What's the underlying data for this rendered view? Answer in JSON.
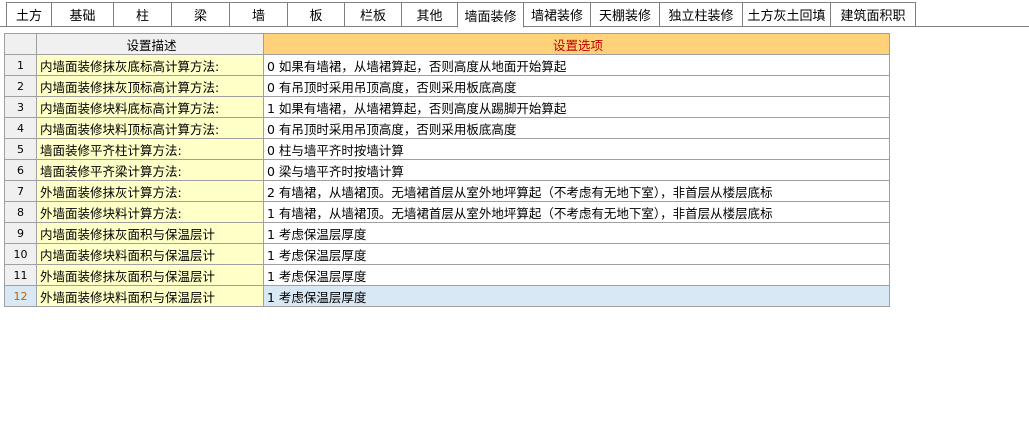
{
  "tabs": [
    {
      "label": "土方"
    },
    {
      "label": "基础"
    },
    {
      "label": "柱"
    },
    {
      "label": "梁"
    },
    {
      "label": "墙"
    },
    {
      "label": "板"
    },
    {
      "label": "栏板"
    },
    {
      "label": "其他"
    },
    {
      "label": "墙面装修"
    },
    {
      "label": "墙裙装修"
    },
    {
      "label": "天棚装修"
    },
    {
      "label": "独立柱装修"
    },
    {
      "label": "土方灰土回填"
    },
    {
      "label": "建筑面积职"
    }
  ],
  "active_tab": "墙面装修",
  "grid": {
    "header_desc": "设置描述",
    "header_option": "设置选项",
    "rows": [
      {
        "num": "1",
        "desc": "内墙面装修抹灰底标高计算方法:",
        "option": "0 如果有墙裙，从墙裙算起，否则高度从地面开始算起"
      },
      {
        "num": "2",
        "desc": "内墙面装修抹灰顶标高计算方法:",
        "option": "0 有吊顶时采用吊顶高度，否则采用板底高度"
      },
      {
        "num": "3",
        "desc": "内墙面装修块料底标高计算方法:",
        "option": "1 如果有墙裙，从墙裙算起，否则高度从踢脚开始算起"
      },
      {
        "num": "4",
        "desc": "内墙面装修块料顶标高计算方法:",
        "option": "0 有吊顶时采用吊顶高度，否则采用板底高度"
      },
      {
        "num": "5",
        "desc": "墙面装修平齐柱计算方法:",
        "option": "0 柱与墙平齐时按墙计算"
      },
      {
        "num": "6",
        "desc": "墙面装修平齐梁计算方法:",
        "option": "0 梁与墙平齐时按墙计算"
      },
      {
        "num": "7",
        "desc": "外墙面装修抹灰计算方法:",
        "option": "2 有墙裙，从墙裙顶。无墙裙首层从室外地坪算起（不考虑有无地下室），非首层从楼层底标"
      },
      {
        "num": "8",
        "desc": "外墙面装修块料计算方法:",
        "option": "1 有墙裙，从墙裙顶。无墙裙首层从室外地坪算起（不考虑有无地下室），非首层从楼层底标"
      },
      {
        "num": "9",
        "desc": "内墙面装修抹灰面积与保温层计",
        "option": "1 考虑保温层厚度"
      },
      {
        "num": "10",
        "desc": "内墙面装修块料面积与保温层计",
        "option": "1 考虑保温层厚度"
      },
      {
        "num": "11",
        "desc": "外墙面装修抹灰面积与保温层计",
        "option": "1 考虑保温层厚度"
      },
      {
        "num": "12",
        "desc": "外墙面装修块料面积与保温层计",
        "option": "1 考虑保温层厚度"
      }
    ],
    "selected_row": "12"
  }
}
